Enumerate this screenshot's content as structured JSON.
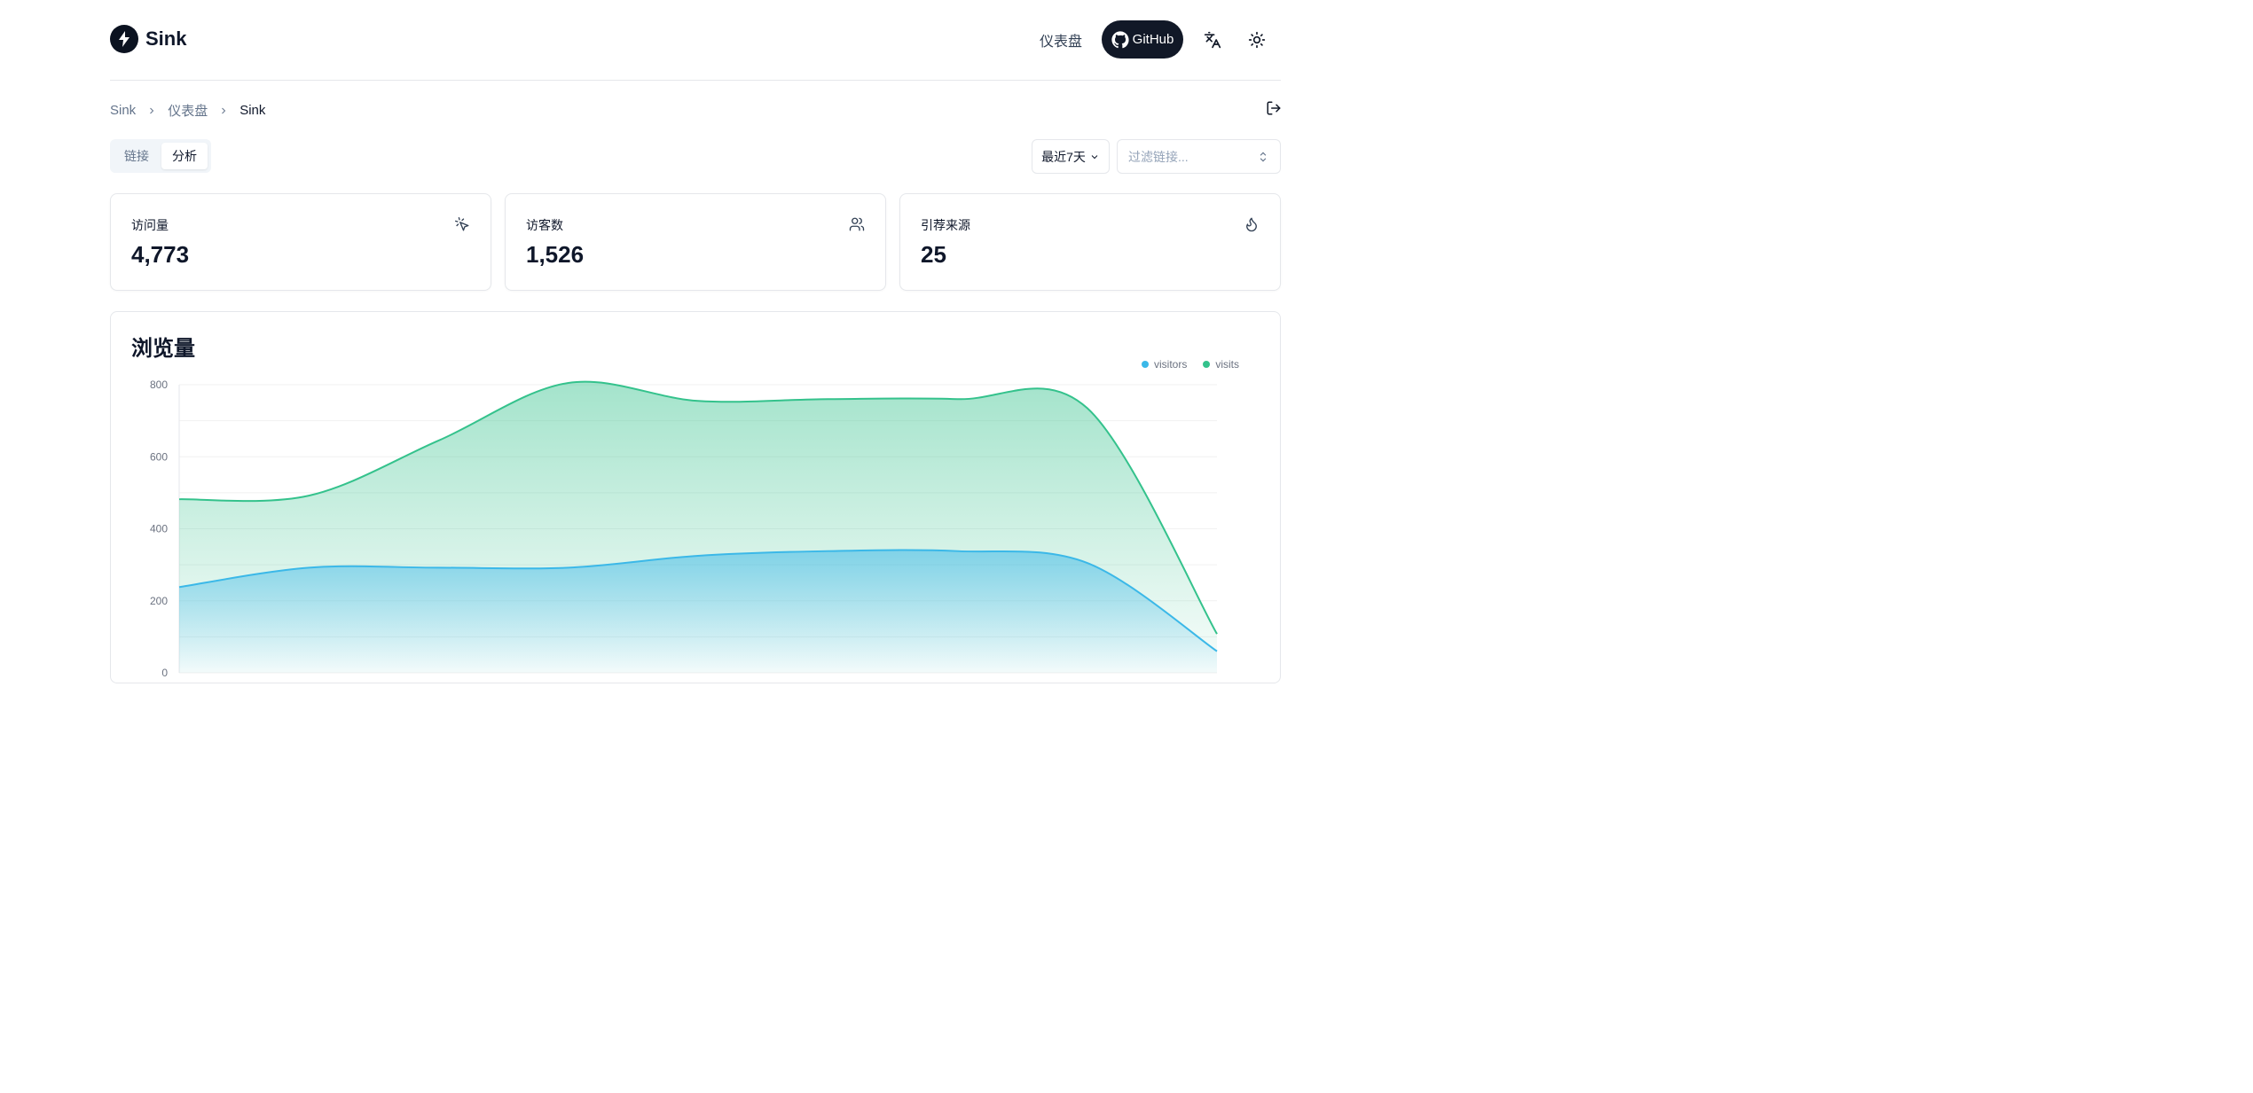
{
  "app": {
    "name": "Sink"
  },
  "nav": {
    "dashboard": "仪表盘",
    "github": "GitHub"
  },
  "breadcrumb": {
    "items": [
      "Sink",
      "仪表盘"
    ],
    "current": "Sink"
  },
  "tabs": [
    {
      "label": "链接",
      "active": false
    },
    {
      "label": "分析",
      "active": true
    }
  ],
  "filters": {
    "range": "最近7天",
    "link_placeholder": "过滤链接..."
  },
  "stats": [
    {
      "label": "访问量",
      "value": "4,773",
      "icon": "mouse-pointer-click-icon"
    },
    {
      "label": "访客数",
      "value": "1,526",
      "icon": "users-icon"
    },
    {
      "label": "引荐来源",
      "value": "25",
      "icon": "flame-icon"
    }
  ],
  "chart": {
    "title": "浏览量"
  },
  "colors": {
    "visits": "#34c28c",
    "visitors": "#3bb8e8",
    "brand_dark": "#111827"
  },
  "chart_data": {
    "type": "area",
    "x": [
      0,
      1,
      2,
      3,
      4,
      5,
      6,
      7,
      8
    ],
    "series": [
      {
        "name": "visitors",
        "values": [
          238,
          292,
          292,
          292,
          325,
          338,
          338,
          305,
          60
        ]
      },
      {
        "name": "visits",
        "values": [
          482,
          492,
          645,
          805,
          755,
          760,
          760,
          735,
          108
        ]
      }
    ],
    "y_ticks": [
      "800",
      "600",
      "400",
      "200",
      "0"
    ],
    "ylim": [
      0,
      800
    ],
    "grid": true,
    "legend": "top-right"
  }
}
